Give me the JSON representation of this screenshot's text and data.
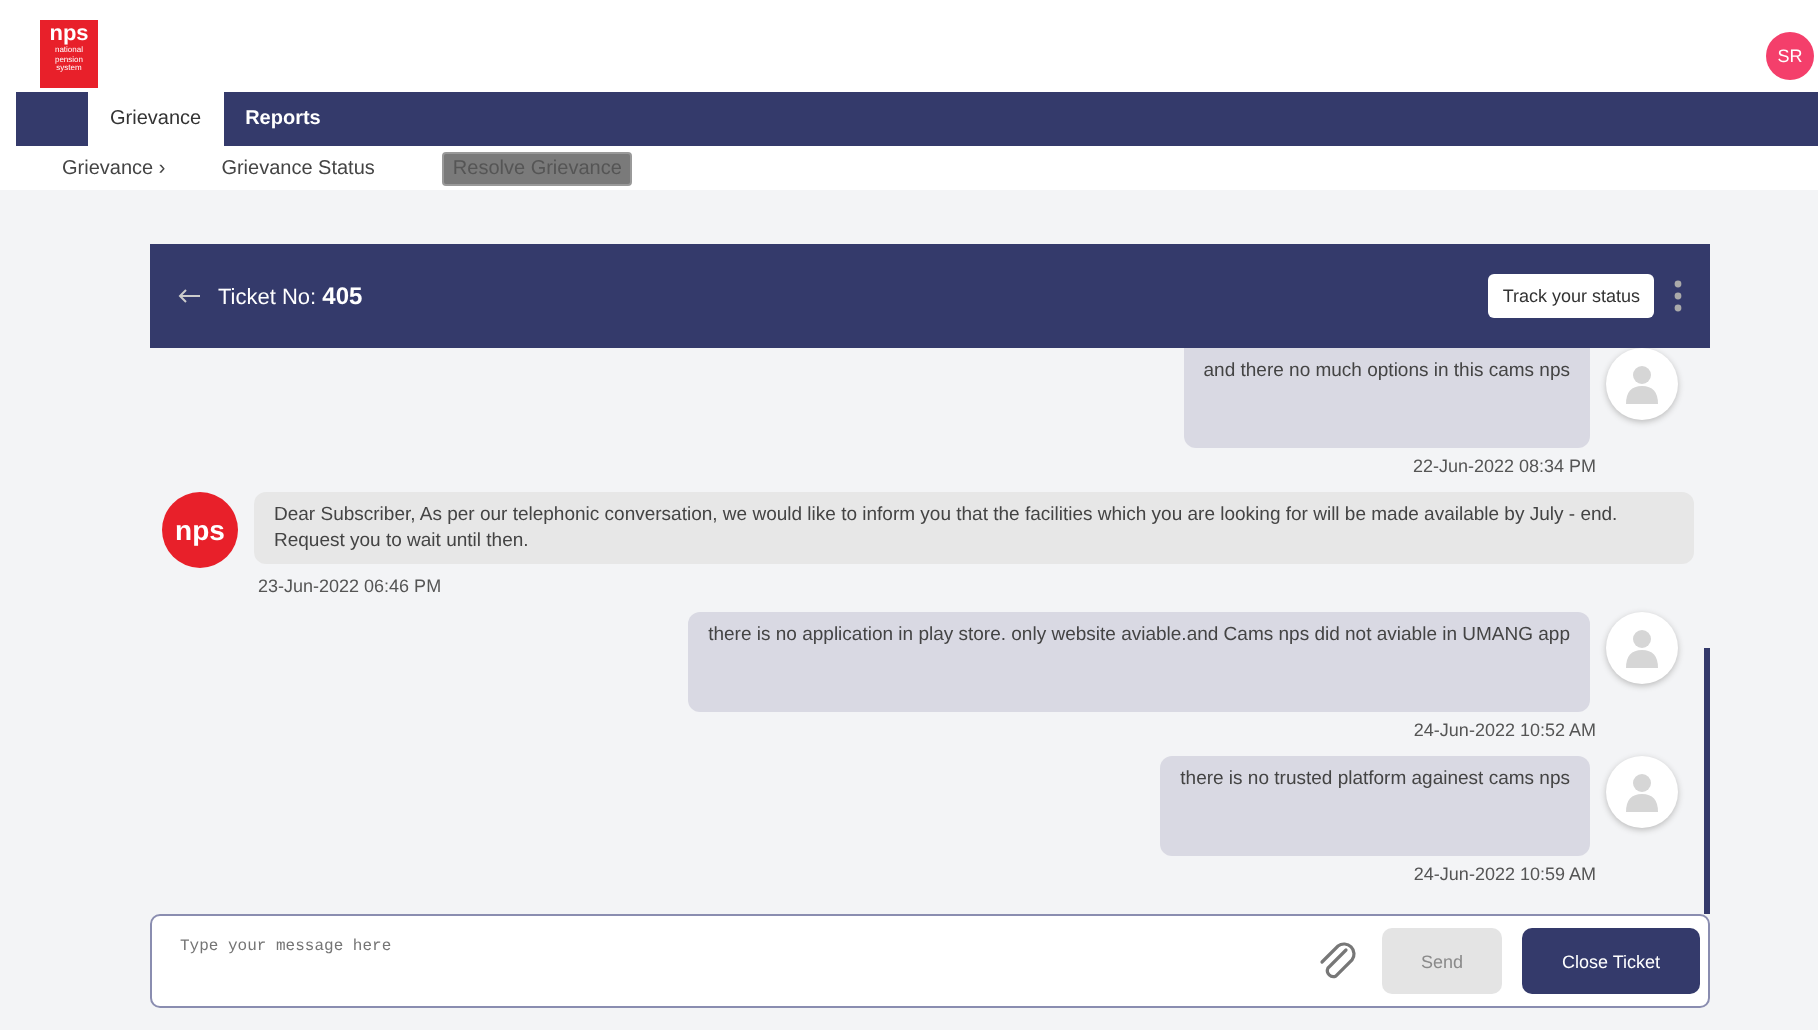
{
  "header": {
    "logo": {
      "mark": "nps",
      "subtitle": "national pension system"
    },
    "user_initials": "SR"
  },
  "tabs": [
    {
      "label": "Grievance",
      "selected": true
    },
    {
      "label": "Reports",
      "selected": false
    }
  ],
  "breadcrumb": [
    {
      "label": "Grievance ›",
      "selected": false
    },
    {
      "label": "Grievance Status",
      "selected": false
    },
    {
      "label": "Resolve Grievance",
      "selected": true
    }
  ],
  "ticket": {
    "label": "Ticket No:",
    "number": "405",
    "track_button": "Track your status"
  },
  "messages": [
    {
      "kind": "user",
      "text": "and there no much options in this cams nps",
      "time": "22-Jun-2022 08:34 PM"
    },
    {
      "kind": "agent",
      "avatar": "nps",
      "text": "Dear Subscriber, As per our telephonic conversation, we would like to inform you that the facilities which you are looking for will be made available by July - end. Request you to wait until then.",
      "time": "23-Jun-2022 06:46 PM"
    },
    {
      "kind": "user",
      "text": "there is no application in play store. only website aviable.and Cams nps did not aviable in UMANG app",
      "time": "24-Jun-2022 10:52 AM"
    },
    {
      "kind": "user",
      "text": "there is no trusted platform againest cams nps",
      "time": "24-Jun-2022 10:59 AM"
    }
  ],
  "composer": {
    "placeholder": "Type your message here",
    "send": {
      "label": "Send",
      "disabled": true
    },
    "close_button": "Close Ticket"
  }
}
